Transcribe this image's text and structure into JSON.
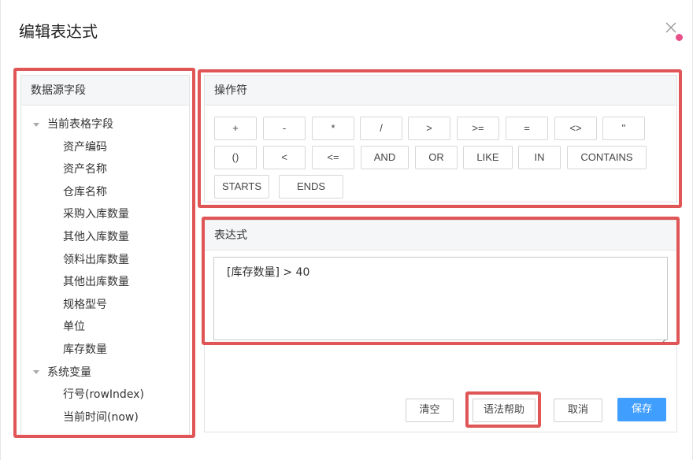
{
  "dialog": {
    "title": "编辑表达式"
  },
  "fields_panel": {
    "header": "数据源字段",
    "groups": [
      {
        "label": "当前表格字段",
        "items": [
          "资产编码",
          "资产名称",
          "仓库名称",
          "采购入库数量",
          "其他入库数量",
          "领料出库数量",
          "其他出库数量",
          "规格型号",
          "单位",
          "库存数量"
        ]
      },
      {
        "label": "系统变量",
        "items": [
          "行号(rowIndex)",
          "当前时间(now)"
        ]
      }
    ]
  },
  "operators_panel": {
    "header": "操作符",
    "operators": [
      "+",
      "-",
      "*",
      "/",
      ">",
      ">=",
      "=",
      "<>",
      "''",
      "()",
      "<",
      "<=",
      "AND",
      "OR",
      "LIKE",
      "IN",
      "CONTAINS",
      "STARTS",
      "ENDS"
    ]
  },
  "expression_panel": {
    "header": "表达式",
    "value": "[库存数量] > 40"
  },
  "actions": {
    "clear_label": "清空",
    "help_label": "语法帮助",
    "cancel_label": "取消",
    "save_label": "保存"
  },
  "colors": {
    "primary": "#409eff",
    "highlight": "#e05555",
    "notification_dot": "#e8508a"
  }
}
